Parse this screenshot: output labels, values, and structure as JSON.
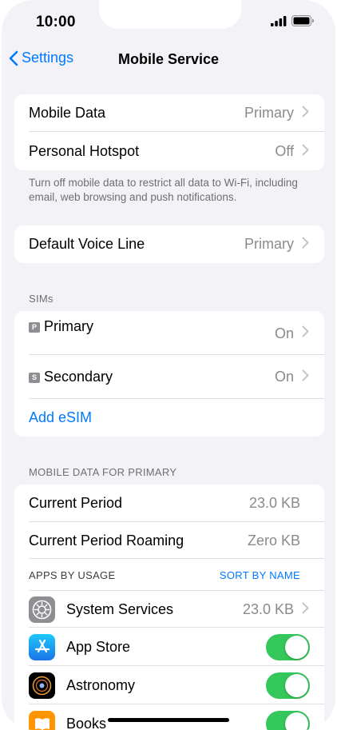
{
  "status_bar": {
    "time": "10:00"
  },
  "nav": {
    "back_label": "Settings",
    "title": "Mobile Service"
  },
  "group1": {
    "rows": [
      {
        "label": "Mobile Data",
        "value": "Primary"
      },
      {
        "label": "Personal Hotspot",
        "value": "Off"
      }
    ],
    "footnote": "Turn off mobile data to restrict all data to Wi-Fi, including email, web browsing and push notifications."
  },
  "group2": {
    "label": "Default Voice Line",
    "value": "Primary"
  },
  "sims": {
    "header": "SIMs",
    "items": [
      {
        "badge": "P",
        "label": "Primary",
        "value": "On"
      },
      {
        "badge": "S",
        "label": "Secondary",
        "value": "On"
      }
    ],
    "add_esim": "Add eSIM"
  },
  "usage": {
    "header": "MOBILE DATA FOR PRIMARY",
    "current_period": {
      "label": "Current Period",
      "value": "23.0 KB"
    },
    "roaming": {
      "label": "Current Period Roaming",
      "value": "Zero KB"
    },
    "apps_header": "APPS BY USAGE",
    "sort_label": "SORT BY NAME",
    "apps": [
      {
        "label": "System Services",
        "value": "23.0 KB",
        "icon": "gear-icon"
      },
      {
        "label": "App Store",
        "toggle": true,
        "icon": "app-store-icon"
      },
      {
        "label": "Astronomy",
        "toggle": true,
        "icon": "astronomy-icon"
      },
      {
        "label": "Books",
        "toggle": true,
        "icon": "books-icon"
      }
    ]
  },
  "colors": {
    "accent": "#007aff",
    "toggle_on": "#34c759",
    "background": "#f2f2f7"
  }
}
